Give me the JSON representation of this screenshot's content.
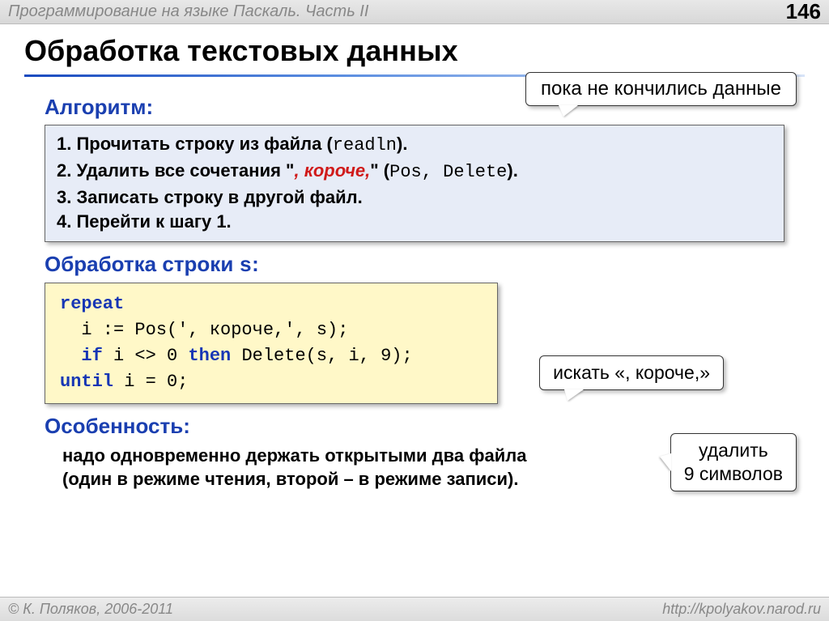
{
  "header": {
    "breadcrumb": "Программирование на языке Паскаль. Часть II",
    "page_number": "146"
  },
  "title": "Обработка текстовых данных",
  "callouts": {
    "loop_condition": "пока не кончились данные",
    "search": "искать «, короче,»",
    "delete_l1": "удалить",
    "delete_l2": "9 символов"
  },
  "sections": {
    "algorithm_label": "Алгоритм:",
    "processing_label_pre": "Обработка строки ",
    "processing_label_code": "s",
    "processing_label_post": ":",
    "feature_label": "Особенность:"
  },
  "algorithm": {
    "l1_pre": "1. Прочитать строку из файла (",
    "l1_code": "readln",
    "l1_post": ").",
    "l2_pre": "2. Удалить все сочетания \"",
    "l2_red": ", короче,",
    "l2_mid": "\" (",
    "l2_code": "Pos, Delete",
    "l2_post": ").",
    "l3": "3. Записать строку в другой файл.",
    "l4": "4. Перейти к шагу 1."
  },
  "code": {
    "kw_repeat": "repeat",
    "line2": "  i := Pos(', короче,', s);",
    "line3_pre": "  ",
    "line3_if": "if",
    "line3_mid": " i <> 0 ",
    "line3_then": "then",
    "line3_post": " Delete(s, i, 9);",
    "kw_until": "until",
    "line4_post": " i = 0;"
  },
  "feature": {
    "l1": "надо одновременно держать открытыми два файла",
    "l2": "(один в режиме чтения, второй – в режиме записи)."
  },
  "footer": {
    "copyright": "© К. Поляков, 2006-2011",
    "url": "http://kpolyakov.narod.ru"
  }
}
